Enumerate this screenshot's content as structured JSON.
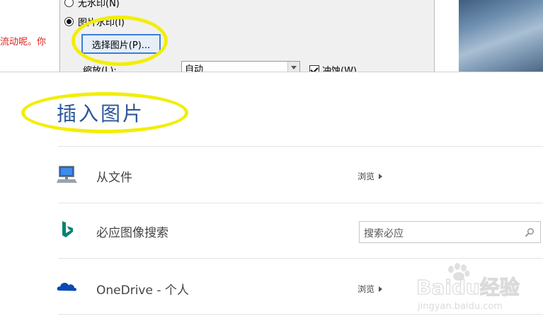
{
  "background_document": {
    "text": "流动呢。你"
  },
  "watermark_dialog": {
    "no_watermark_label": "无水印(N)",
    "picture_watermark_label": "图片水印(I)",
    "select_picture_button": "选择图片(P)...",
    "scale_label": "缩放(L):",
    "scale_value": "自动",
    "washout_label": "冲蚀(W)",
    "washout_checked": true
  },
  "insert_pictures": {
    "title": "插入图片",
    "sources": [
      {
        "icon": "computer-icon",
        "label": "从文件",
        "action": "浏览"
      },
      {
        "icon": "bing-icon",
        "label": "必应图像搜索",
        "search_placeholder": "搜索必应"
      },
      {
        "icon": "onedrive-cloud-icon",
        "label": "OneDrive - 个人",
        "action": "浏览"
      }
    ]
  },
  "watermark_logo": {
    "text": "Baidu经验",
    "url": "jingyan.baidu.com"
  },
  "colors": {
    "title_blue": "#2b579a",
    "highlight_yellow": "#f2ee07",
    "bing_teal": "#008373",
    "onedrive_blue": "#094ab2",
    "doc_red": "#e02020"
  }
}
